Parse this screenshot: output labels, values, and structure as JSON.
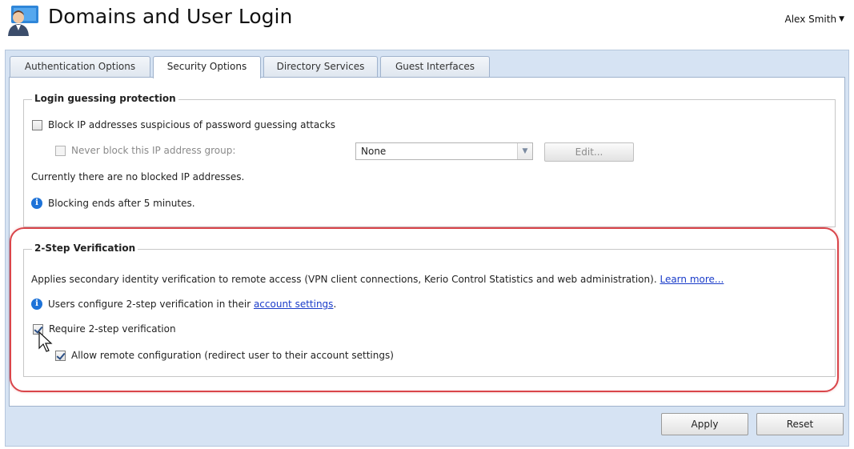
{
  "header": {
    "title": "Domains and User Login",
    "user_name": "Alex Smith",
    "user_menu_icon": "caret-down-icon",
    "app_icon": "user-domain-icon"
  },
  "tabs": [
    {
      "label": "Authentication Options",
      "active": false
    },
    {
      "label": "Security Options",
      "active": true
    },
    {
      "label": "Directory Services",
      "active": false
    },
    {
      "label": "Guest Interfaces",
      "active": false
    }
  ],
  "login_protection": {
    "legend": "Login guessing protection",
    "block_ip_label": "Block IP addresses suspicious of password guessing attacks",
    "block_ip_checked": false,
    "never_block_label": "Never block this IP address group:",
    "never_block_checked": false,
    "never_block_enabled": false,
    "ip_group_value": "None",
    "edit_label": "Edit...",
    "no_blocked_text": "Currently there are no blocked IP addresses.",
    "blocking_info": "Blocking ends after 5 minutes."
  },
  "two_step": {
    "legend": "2-Step Verification",
    "description": "Applies secondary identity verification to remote access (VPN client connections, Kerio Control Statistics and web administration).",
    "learn_more": "Learn more...",
    "info_prefix": "Users configure 2-step verification in their",
    "info_link": "account settings",
    "info_suffix": ".",
    "require_label": "Require 2-step verification",
    "require_checked": true,
    "allow_remote_label": "Allow remote configuration (redirect user to their account settings)",
    "allow_remote_checked": true
  },
  "footer": {
    "apply_label": "Apply",
    "reset_label": "Reset"
  },
  "colors": {
    "panel_bg": "#d6e3f3",
    "highlight": "#d9454a",
    "link": "#1a3cc9",
    "info": "#1e73d8"
  }
}
